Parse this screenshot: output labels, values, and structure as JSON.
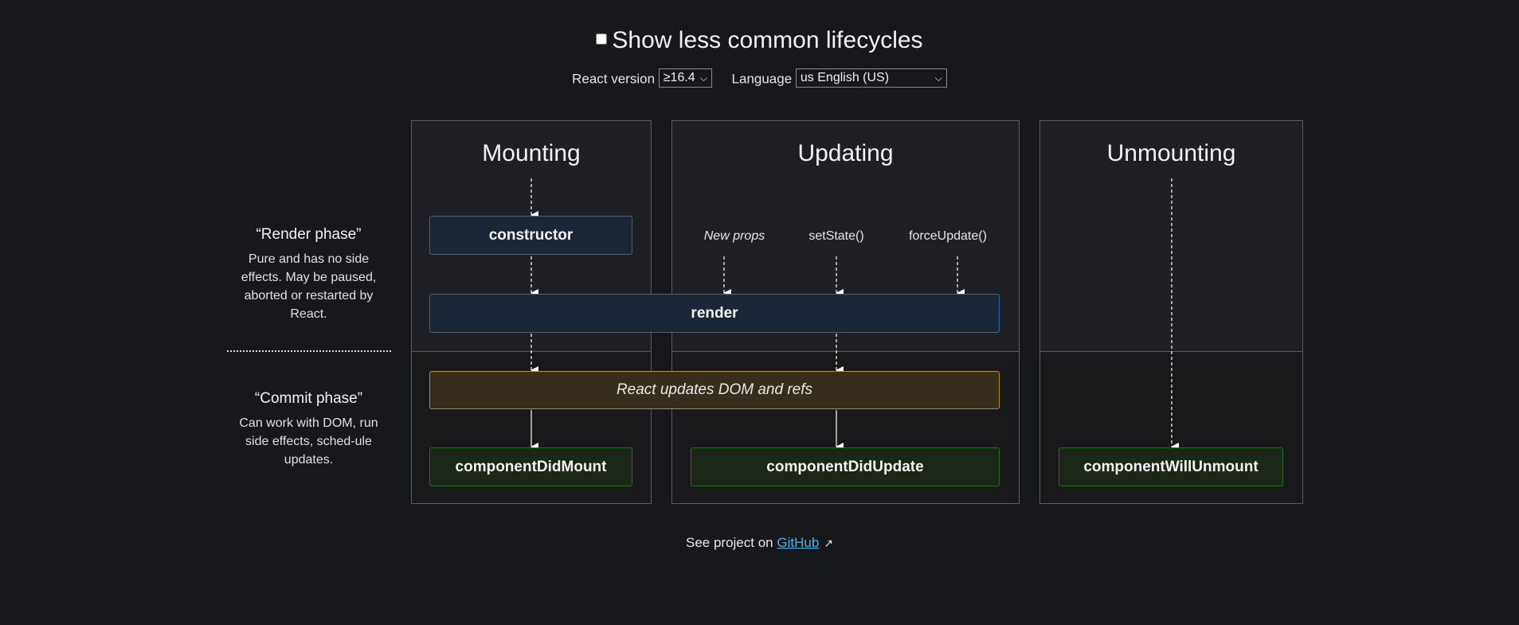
{
  "toggle": {
    "label": "Show less common lifecycles",
    "checked": false
  },
  "controls": {
    "version_label": "React version",
    "version_value": "≥16.4",
    "language_label": "Language",
    "language_value": "us English (US)"
  },
  "phases": {
    "render": {
      "title": "“Render phase”",
      "description": "Pure and has no side effects. May be paused, aborted or restarted by React."
    },
    "commit": {
      "title": "“Commit phase”",
      "description": "Can work with DOM, run side effects, sched-ule updates."
    }
  },
  "columns": {
    "mounting": "Mounting",
    "updating": "Updating",
    "unmounting": "Unmounting"
  },
  "triggers": {
    "new_props": "New props",
    "set_state": "setState()",
    "force_update": "forceUpdate()"
  },
  "methods": {
    "constructor": "constructor",
    "render": "render",
    "react_updates": "React updates DOM and refs",
    "component_did_mount": "componentDidMount",
    "component_did_update": "componentDidUpdate",
    "component_will_unmount": "componentWillUnmount"
  },
  "footer": {
    "prefix": "See project on",
    "link": "GitHub"
  },
  "colors": {
    "background": "#17181c",
    "render_box": "#1b2637",
    "commit_box": "#372d1c",
    "did_box": "#1c2619",
    "link": "#48b6e8"
  }
}
